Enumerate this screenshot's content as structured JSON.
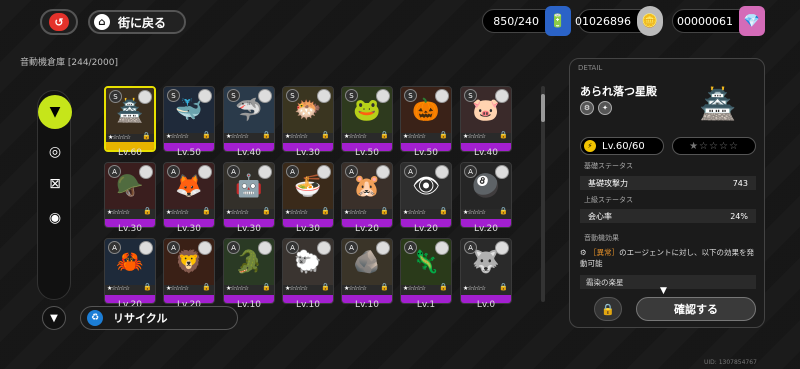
{
  "topbar": {
    "back_icon": "return-icon",
    "back_glyph": "↺",
    "home_glyph": "⌂",
    "town_label": "街に戻る",
    "battery": "850/240",
    "denny": "01026896",
    "polychrome": "00000061"
  },
  "storage": {
    "title": "音動機倉庫 [244/2000]"
  },
  "rail": {
    "tabs": [
      "w-engine-icon",
      "disc-icon",
      "bangboo-icon",
      "ring-icon"
    ]
  },
  "cards": [
    {
      "lv": "Lv.60",
      "art": "🏯",
      "rank": "S",
      "color": "#3b2f20",
      "selected": true
    },
    {
      "lv": "Lv.50",
      "art": "🐳",
      "rank": "S",
      "color": "#1f2a3a"
    },
    {
      "lv": "Lv.40",
      "art": "🦈",
      "rank": "S",
      "color": "#2a3a4a"
    },
    {
      "lv": "Lv.30",
      "art": "🐡",
      "rank": "S",
      "color": "#3a3520"
    },
    {
      "lv": "Lv.50",
      "art": "🐸",
      "rank": "S",
      "color": "#2e3a1e"
    },
    {
      "lv": "Lv.50",
      "art": "🎃",
      "rank": "S",
      "color": "#3a2218"
    },
    {
      "lv": "Lv.40",
      "art": "🐷",
      "rank": "S",
      "color": "#3a2a2a"
    },
    {
      "lv": "Lv.30",
      "art": "🪖",
      "rank": "A",
      "color": "#3a1e1e"
    },
    {
      "lv": "Lv.30",
      "art": "🦊",
      "rank": "A",
      "color": "#3a2020"
    },
    {
      "lv": "Lv.30",
      "art": "🤖",
      "rank": "A",
      "color": "#33302a"
    },
    {
      "lv": "Lv.30",
      "art": "🍜",
      "rank": "A",
      "color": "#3a2a1a"
    },
    {
      "lv": "Lv.20",
      "art": "🐹",
      "rank": "A",
      "color": "#3a302a"
    },
    {
      "lv": "Lv.20",
      "art": "👁",
      "rank": "A",
      "color": "#2e2e2e"
    },
    {
      "lv": "Lv.20",
      "art": "🎱",
      "rank": "A",
      "color": "#262626"
    },
    {
      "lv": "Lv.20",
      "art": "🦀",
      "rank": "A",
      "color": "#1e2a3a"
    },
    {
      "lv": "Lv.20",
      "art": "🦁",
      "rank": "A",
      "color": "#3a2016"
    },
    {
      "lv": "Lv.10",
      "art": "🐊",
      "rank": "A",
      "color": "#2a3a24"
    },
    {
      "lv": "Lv.10",
      "art": "🐑",
      "rank": "A",
      "color": "#3a3430"
    },
    {
      "lv": "Lv.10",
      "art": "🪨",
      "rank": "A",
      "color": "#3a3428"
    },
    {
      "lv": "Lv.1",
      "art": "🦎",
      "rank": "A",
      "color": "#2a3a1a"
    },
    {
      "lv": "Lv.0",
      "art": "🐺",
      "rank": "A",
      "color": "#2a2a2a"
    }
  ],
  "bottom": {
    "filter_glyph": "▼",
    "recycle_glyph": "♻",
    "recycle_label": "リサイクル"
  },
  "detail": {
    "header": "DETAIL",
    "name": "あられ落つ星殿",
    "portrait": "🏯",
    "level": "Lv.60/60",
    "stars": "★☆☆☆☆",
    "base_stats_title": "基礎ステータス",
    "base_stat_name": "基礎攻撃力",
    "base_stat_value": "743",
    "upper_stats_title": "上級ステータス",
    "upper_stat_name": "会心率",
    "upper_stat_value": "24%",
    "effect_title": "音動機効果",
    "effect_tag": "［異常］",
    "effect_text": "のエージェントに対し、以下の効果を発動可能",
    "pollution_label": "霜染の楽星",
    "confirm_label": "確認する"
  },
  "footer": {
    "uid": "UID: 1307854767"
  }
}
